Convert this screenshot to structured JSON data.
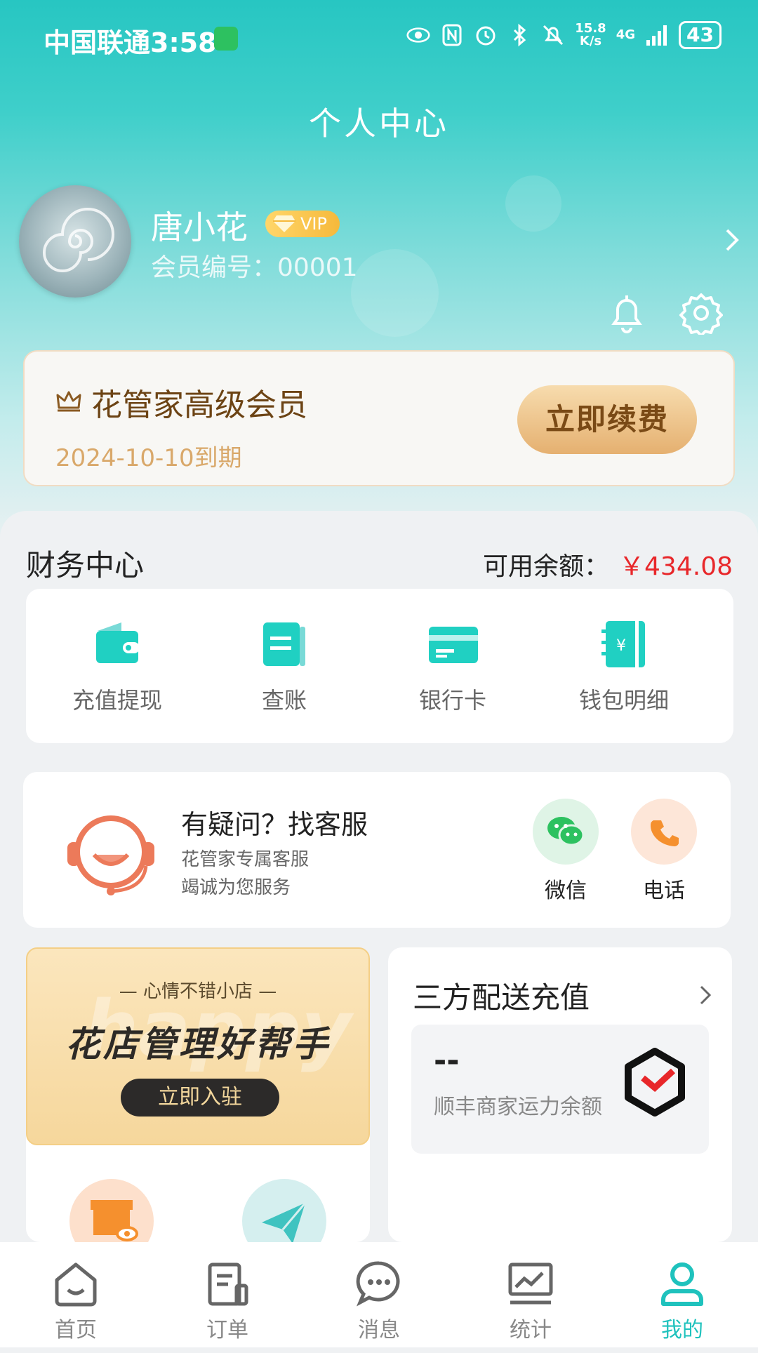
{
  "colors": {
    "accent": "#1fc2bd",
    "header": "#27c6c2",
    "price": "#e8272a",
    "gold": "#e5b070"
  },
  "status_bar": {
    "carrier": "中国联通",
    "time": "3:58",
    "net_speed_value": "15.8",
    "net_speed_unit": "K/s",
    "network": "4G",
    "battery": "43"
  },
  "header": {
    "title": "个人中心"
  },
  "profile": {
    "name": "唐小花",
    "vip_label": "VIP",
    "member_no_label": "会员编号：",
    "member_no": "00001"
  },
  "membership": {
    "title": "花管家高级会员",
    "expiry": "2024-10-10到期",
    "renew_label": "立即续费"
  },
  "finance": {
    "title": "财务中心",
    "balance_label": "可用余额：",
    "balance_value": "￥434.08",
    "items": [
      {
        "label": "充值提现",
        "icon": "wallet-icon"
      },
      {
        "label": "查账",
        "icon": "ledger-icon"
      },
      {
        "label": "银行卡",
        "icon": "bank-card-icon"
      },
      {
        "label": "钱包明细",
        "icon": "wallet-detail-icon"
      }
    ]
  },
  "service": {
    "title": "有疑问？找客服",
    "sub1": "花管家专属客服",
    "sub2": "竭诚为您服务",
    "wechat_label": "微信",
    "phone_label": "电话"
  },
  "promo": {
    "bg_text": "happy",
    "subtitle": "— 心情不错小店 —",
    "main": "花店管理好帮手",
    "button": "立即入驻"
  },
  "delivery": {
    "title": "三方配送充值",
    "value": "--",
    "label": "顺丰商家运力余额"
  },
  "bottom_nav": [
    {
      "label": "首页",
      "icon": "home-icon"
    },
    {
      "label": "订单",
      "icon": "order-icon"
    },
    {
      "label": "消息",
      "icon": "message-icon"
    },
    {
      "label": "统计",
      "icon": "stats-icon"
    },
    {
      "label": "我的",
      "icon": "profile-icon",
      "active": true
    }
  ]
}
